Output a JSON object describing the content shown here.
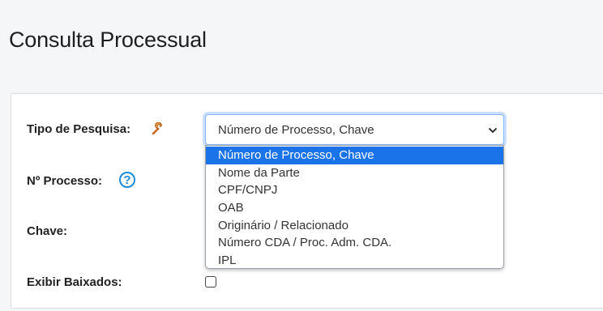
{
  "page": {
    "title": "Consulta Processual"
  },
  "form": {
    "tipo_label": "Tipo de Pesquisa:",
    "processo_label": "Nº Processo:",
    "chave_label": "Chave:",
    "baixados_label": "Exibir Baixados:",
    "help_glyph": "?",
    "select_value": "Número de Processo, Chave",
    "options": [
      "Número de Processo, Chave",
      "Nome da Parte",
      "CPF/CNPJ",
      "OAB",
      "Originário / Relacionado",
      "Número CDA / Proc. Adm. CDA.",
      "IPL"
    ],
    "selected_index": 0,
    "exibir_baixados_checked": false
  },
  "icons": {
    "settings": "wrench-icon",
    "help": "help-icon",
    "dropdown": "chevron-down-icon"
  },
  "colors": {
    "focus_border": "#86b7fe",
    "selected_option_bg": "#1a73e8",
    "help_icon": "#1e8bd8"
  }
}
